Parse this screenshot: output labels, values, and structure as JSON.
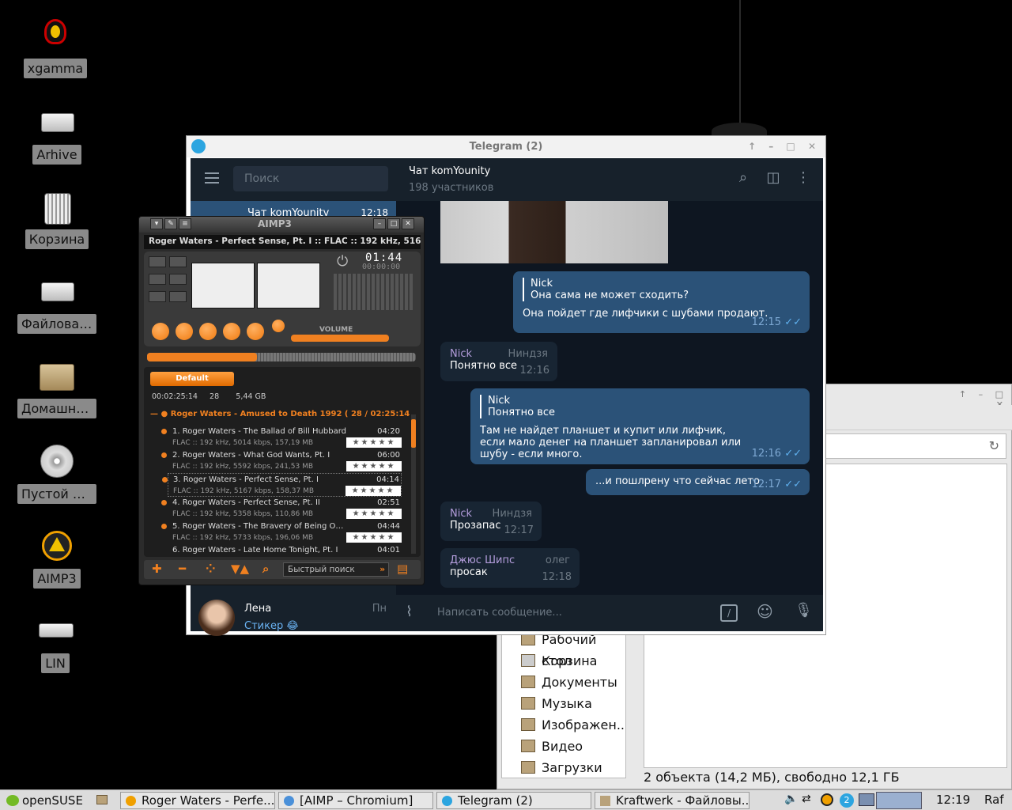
{
  "desktop": {
    "icons": [
      {
        "label": "xgamma",
        "icon": "lightbulb-icon"
      },
      {
        "label": "Arhive",
        "icon": "drive-icon"
      },
      {
        "label": "Корзина",
        "icon": "trash-icon"
      },
      {
        "label": "Файловая ...",
        "icon": "drive-icon"
      },
      {
        "label": "Домашни...",
        "icon": "home-folder-icon"
      },
      {
        "label": "Пустой Ди...",
        "icon": "disc-icon"
      },
      {
        "label": "AIMP3",
        "icon": "aimp-icon"
      },
      {
        "label": "LIN",
        "icon": "drive-icon"
      }
    ]
  },
  "file_manager": {
    "sidebar": [
      "Рабочий стол",
      "Корзина",
      "Документы",
      "Музыка",
      "Изображен...",
      "Видео",
      "Загрузки"
    ],
    "status": "2 объекта (14,2 МБ), свободно 12,1 ГБ"
  },
  "telegram": {
    "title": "Telegram (2)",
    "search_placeholder": "Поиск",
    "selected_chat": {
      "name": "Чат komYounity",
      "time": "12:18"
    },
    "lena": {
      "name": "Лена",
      "day": "Пн",
      "message": "Стикер 😂"
    },
    "header": {
      "title": "Чат komYounity",
      "subtitle": "198 участников"
    },
    "messages": [
      {
        "quote_name": "Nick",
        "quote": "Она сама не может сходить?",
        "text": "Она пойдет где лифчики с шубами продают.",
        "time": "12:15"
      },
      {
        "sender": "Nick",
        "role": "Ниндзя",
        "text": "Понятно все",
        "time": "12:16"
      },
      {
        "quote_name": "Nick",
        "quote": "Понятно все",
        "text": "Там не найдет планшет и купит или лифчик, если мало денег на планшет запланировал или шубу - если много.",
        "time": "12:16"
      },
      {
        "text": "...и пошлрену что сейчас лето",
        "time": "12:17"
      },
      {
        "sender": "Nick",
        "role": "Ниндзя",
        "text": "Прозапас",
        "time": "12:17"
      },
      {
        "sender": "Джюс Шипс",
        "role": "олег",
        "text": "просак",
        "time": "12:18"
      }
    ],
    "compose_placeholder": "Написать сообщение..."
  },
  "aimp": {
    "brand": "AIMP3",
    "track": "Roger Waters - Perfect Sense, Pt. I :: FLAC :: 192 kHz, 5167 kbps",
    "time": "01:44",
    "time_remaining": "00:00:00",
    "volume_label": "VOLUME",
    "playlist_tab": "Default",
    "stats": "00:02:25:14     28       5,44 GB",
    "group": "Roger Waters - Amused to Death 1992 ( 28 / 02:25:14",
    "tracks": [
      {
        "name": "1. Roger Waters - The Ballad of Bill Hubbard",
        "dur": "04:20",
        "info": "FLAC :: 192 kHz, 5014 kbps, 157,19 MB"
      },
      {
        "name": "2. Roger Waters - What God Wants, Pt. I",
        "dur": "06:00",
        "info": "FLAC :: 192 kHz, 5592 kbps, 241,53 MB"
      },
      {
        "name": "3. Roger Waters - Perfect Sense, Pt. I",
        "dur": "04:14",
        "info": "FLAC :: 192 kHz, 5167 kbps, 158,37 MB"
      },
      {
        "name": "4. Roger Waters - Perfect Sense, Pt. II",
        "dur": "02:51",
        "info": "FLAC :: 192 kHz, 5358 kbps, 110,86 MB"
      },
      {
        "name": "5. Roger Waters - The Bravery of Being Out of Ra...",
        "dur": "04:44",
        "info": "FLAC :: 192 kHz, 5733 kbps, 196,06 MB"
      },
      {
        "name": "6. Roger Waters - Late Home Tonight, Pt. I",
        "dur": "04:01",
        "info": ""
      }
    ],
    "quick_search": "Быстрый поиск",
    "seek_fraction": 0.41
  },
  "taskbar": {
    "start": "openSUSE",
    "items": [
      "Roger Waters - Perfe...",
      "[AIMP – Chromium]",
      "Telegram (2)",
      "Kraftwerk - Файловы..."
    ],
    "clock": "12:19",
    "user": "Raf",
    "badge": "2"
  }
}
